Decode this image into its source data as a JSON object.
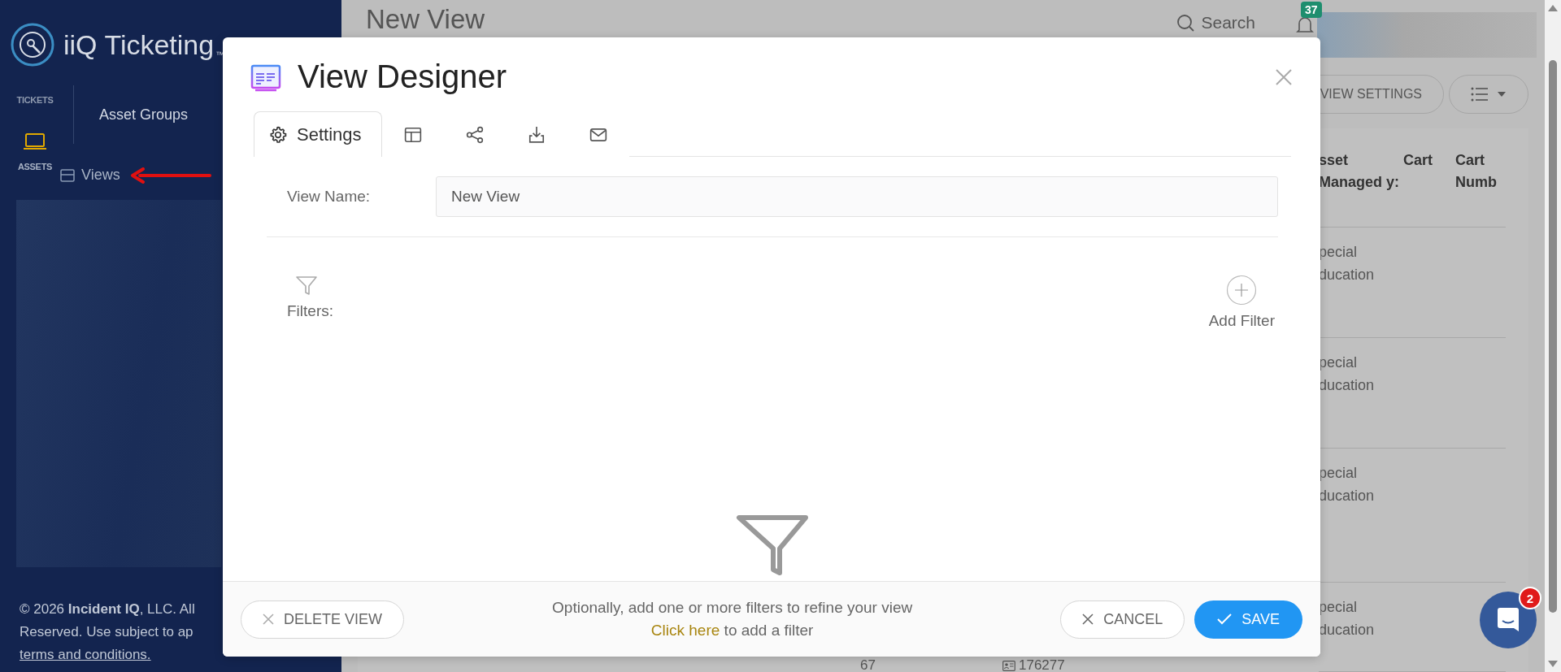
{
  "sidebar": {
    "logo_text": "iiQ Ticketing",
    "trademark": "™",
    "modules": [
      {
        "label": "TICKETS",
        "kind": "text",
        "selected": false
      },
      {
        "label": "ASSETS",
        "kind": "laptop",
        "selected": true
      }
    ],
    "menu": [
      {
        "label": "Asset Groups",
        "kind": "group"
      },
      {
        "label": "Views",
        "kind": "views"
      }
    ],
    "copyright_lines": [
      "© 2026 **Incident IQ**, LLC. All",
      "Reserved. Use subject to ap"
    ],
    "terms_link": "terms and conditions."
  },
  "page": {
    "title": "New View",
    "search_label": "Search",
    "notification_count": "37",
    "toolbar_buttons": [
      {
        "kind": "text",
        "label": "VIEW SETTINGS"
      },
      {
        "kind": "list-menu"
      }
    ]
  },
  "table": {
    "columns": [
      {
        "label": "sset Managed y:"
      },
      {
        "label": "Cart"
      },
      {
        "label": "Cart Numb"
      }
    ],
    "rows": [
      {
        "column_3": "pecial ducation"
      },
      {
        "column_3": "pecial ducation"
      },
      {
        "column_3": "pecial ducation"
      },
      {
        "column_1": "67",
        "column_2": "176277",
        "column_3": "pecial ducation"
      }
    ]
  },
  "chat": {
    "badge": "2"
  },
  "dialog": {
    "title": "View Designer",
    "tabs": [
      {
        "kind": "settings",
        "label": "Settings",
        "selected": true
      },
      {
        "kind": "layout",
        "selected": false
      },
      {
        "kind": "share",
        "selected": false
      },
      {
        "kind": "download",
        "selected": false
      },
      {
        "kind": "email",
        "selected": false
      }
    ],
    "fields": [
      {
        "label": "View Name:",
        "value": "New View"
      }
    ],
    "filters_label": "Filters:",
    "add_filter_label": "Add Filter",
    "footer": {
      "delete_label": "DELETE VIEW",
      "hint": "Optionally, add one or more filters to refine your view",
      "link": "Click here",
      "link_suffix": " to add a filter",
      "cancel_label": "CANCEL",
      "save_label": "SAVE"
    }
  }
}
